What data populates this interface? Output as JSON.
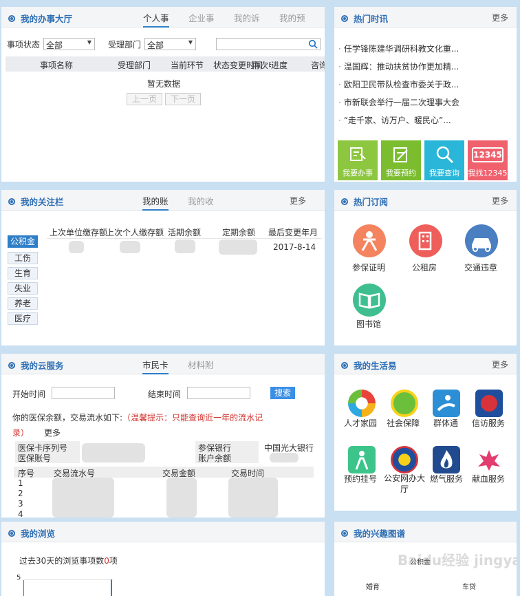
{
  "office": {
    "title": "我的办事大厅",
    "tabs": [
      "个人事",
      "企业事",
      "我的诉",
      "我的预"
    ],
    "status_label": "事项状态",
    "status_value": "全部",
    "dept_label": "受理部门",
    "dept_value": "全部",
    "columns": [
      "事项名称",
      "受理部门",
      "当前环节",
      "状态变更时间",
      "再次申办",
      "进度",
      "咨询"
    ],
    "empty": "暂无数据",
    "prev": "上一页",
    "next": "下一页"
  },
  "news": {
    "title": "热门时讯",
    "more": "更多",
    "items": [
      "任学锋陈建华调研科教文化重...",
      "温国辉：推动扶贫协作更加精...",
      "欧阳卫民带队检查市委关于政...",
      "市新联会举行一届二次理事大会",
      "“走千家、访万户、暖民心”..."
    ]
  },
  "quick": [
    {
      "label": "我要办事",
      "color": "#8dc63f"
    },
    {
      "label": "我要预约",
      "color": "#7bbd2f"
    },
    {
      "label": "我要查询",
      "color": "#29b6d8"
    },
    {
      "label": "我找12345",
      "color": "#f0616e"
    }
  ],
  "focus": {
    "title": "我的关注栏",
    "tabs": [
      "我的账",
      "我的收"
    ],
    "more": "更多",
    "side": [
      "公积金",
      "工伤",
      "生育",
      "失业",
      "养老",
      "医疗"
    ],
    "columns": [
      "上次单位缴存额",
      "上次个人缴存额",
      "活期余额",
      "定期余额",
      "最后变更年月"
    ],
    "date": "2017-8-14"
  },
  "hot": {
    "title": "热门订阅",
    "more": "更多",
    "items": [
      {
        "label": "参保证明",
        "color": "#f4845f"
      },
      {
        "label": "公租房",
        "color": "#ee5f5b"
      },
      {
        "label": "交通违章",
        "color": "#4a7fc1"
      },
      {
        "label": "图书馆",
        "color": "#3fbf8f"
      }
    ]
  },
  "cloud": {
    "title": "我的云服务",
    "tabs": [
      "市民卡",
      "材料附"
    ],
    "start_label": "开始时间",
    "end_label": "结束时间",
    "search": "搜索",
    "desc_prefix": "你的医保余额，交易流水如下:",
    "tip_open": "（",
    "tip": "温馨提示：只能查询近一年的流水记录",
    "tip_close": "）",
    "more": "更多",
    "card_serial": "医保卡序列号",
    "account_no": "医保账号",
    "bank_label": "参保银行",
    "balance_label": "账户余额",
    "bank_value": "中国光大银行",
    "columns": [
      "序号",
      "交易流水号",
      "交易金额",
      "交易时间"
    ],
    "rows": [
      "1",
      "2",
      "3",
      "4"
    ]
  },
  "life": {
    "title": "我的生活易",
    "more": "更多",
    "items": [
      {
        "label": "人才家园",
        "color": "#e8443a"
      },
      {
        "label": "社会保障",
        "color": "#6cbf3b"
      },
      {
        "label": "群体通",
        "color": "#2c8fd6"
      },
      {
        "label": "信访服务",
        "color": "#d8333a"
      },
      {
        "label": "预约挂号",
        "color": "#3cc48a"
      },
      {
        "label": "公安网办大厅",
        "color": "#1f4f9c"
      },
      {
        "label": "燃气服务",
        "color": "#224b8f"
      },
      {
        "label": "献血服务",
        "color": "#e23d6e"
      }
    ]
  },
  "browse": {
    "title": "我的浏览",
    "summary_prefix": "过去30天的浏览事项数",
    "summary_count": "0",
    "summary_suffix": "项",
    "ytick": "5"
  },
  "interest": {
    "title": "我的兴趣图谱",
    "labels": [
      "公积金",
      "婚育",
      "车贷"
    ]
  },
  "watermark": "Baidu经验 jingyan.baidu.com"
}
